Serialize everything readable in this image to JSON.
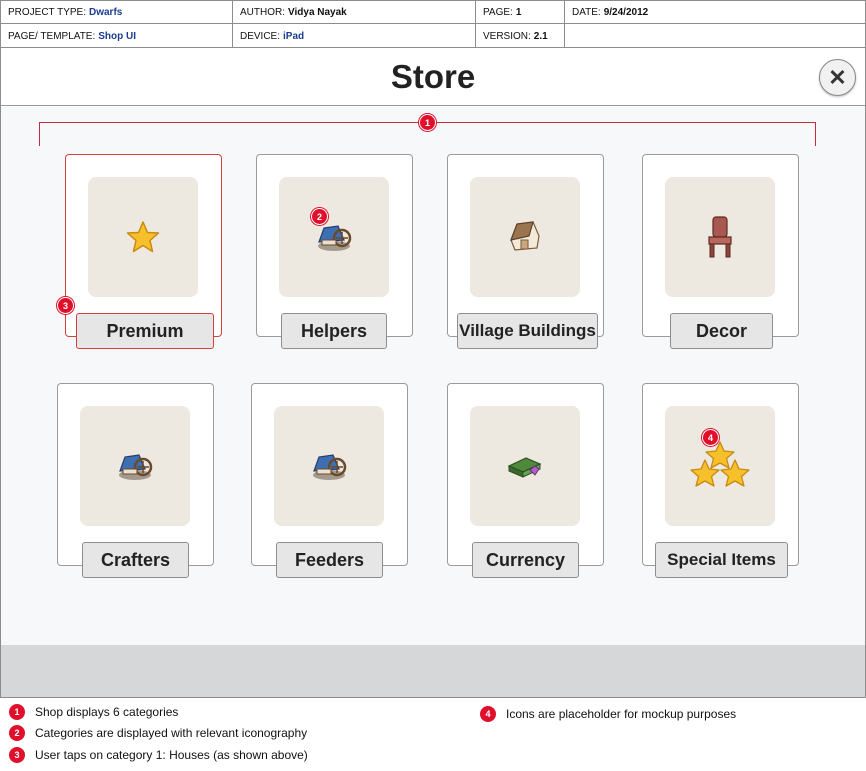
{
  "meta": {
    "project_type_label": "PROJECT TYPE:",
    "project_type": "Dwarfs",
    "author_label": "AUTHOR:",
    "author": "Vidya Nayak",
    "page_label": "PAGE:",
    "page": "1",
    "date_label": "DATE:",
    "date": "9/24/2012",
    "template_label": "PAGE/ TEMPLATE:",
    "template": "Shop UI",
    "device_label": "DEVICE:",
    "device": "iPad",
    "version_label": "VERSION:",
    "version": "2.1"
  },
  "store": {
    "title": "Store",
    "close_glyph": "✕",
    "categories": [
      {
        "label": "Premium",
        "icon": "star-icon",
        "selected": true
      },
      {
        "label": "Helpers",
        "icon": "dwarf-cart-icon",
        "selected": false
      },
      {
        "label": "Village Buildings",
        "icon": "hut-icon",
        "selected": false
      },
      {
        "label": "Decor",
        "icon": "chair-icon",
        "selected": false
      },
      {
        "label": "Crafters",
        "icon": "dwarf-cart-icon",
        "selected": false
      },
      {
        "label": "Feeders",
        "icon": "dwarf-cart-icon",
        "selected": false
      },
      {
        "label": "Currency",
        "icon": "money-stack-icon",
        "selected": false
      },
      {
        "label": "Special Items",
        "icon": "three-stars-icon",
        "selected": false
      }
    ]
  },
  "annotations": {
    "b1": "1",
    "b2": "2",
    "b3": "3",
    "b4": "4"
  },
  "legend": [
    {
      "num": "1",
      "text": "Shop displays 6 categories"
    },
    {
      "num": "2",
      "text": "Categories are displayed with relevant iconography"
    },
    {
      "num": "3",
      "text": "User taps on category 1: Houses (as shown above)"
    },
    {
      "num": "4",
      "text": "Icons are placeholder for mockup purposes"
    }
  ],
  "colors": {
    "accent_red": "#e0102c",
    "link_blue": "#1b3d8f",
    "thumb_bg": "#ede8e0"
  }
}
